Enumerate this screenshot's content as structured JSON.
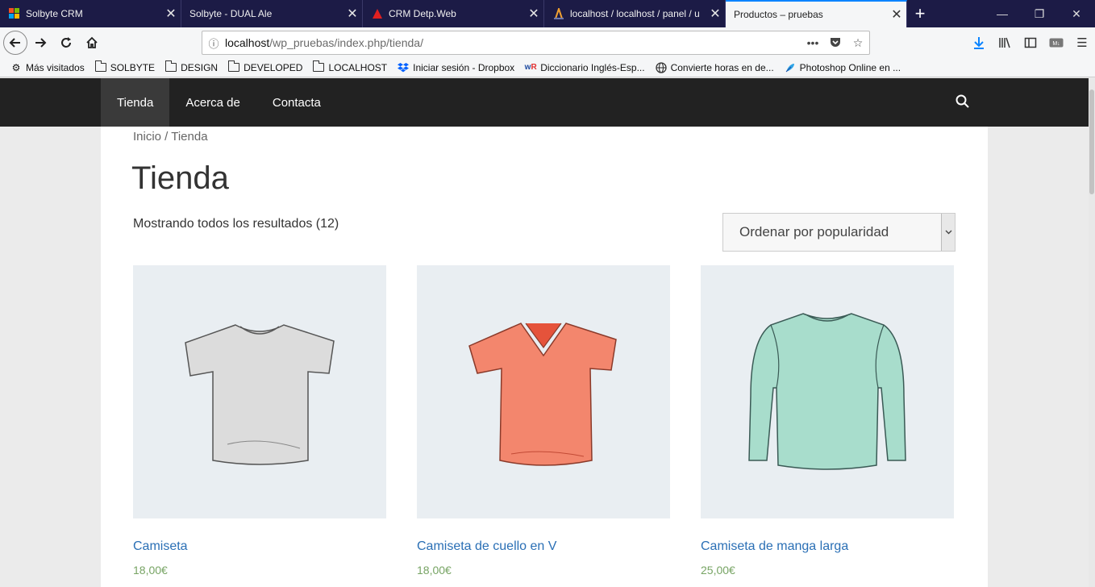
{
  "tabs": [
    {
      "title": "Solbyte CRM"
    },
    {
      "title": "Solbyte - DUAL Ale"
    },
    {
      "title": "CRM Detp.Web"
    },
    {
      "title": "localhost / localhost / panel / u"
    },
    {
      "title": "Productos – pruebas"
    }
  ],
  "address": {
    "host": "localhost",
    "path": "/wp_pruebas/index.php/tienda/"
  },
  "bookmarks": [
    {
      "label": "Más visitados",
      "icon": "gear-icon"
    },
    {
      "label": "SOLBYTE",
      "icon": "folder-icon"
    },
    {
      "label": "DESIGN",
      "icon": "folder-icon"
    },
    {
      "label": "DEVELOPED",
      "icon": "folder-icon"
    },
    {
      "label": "LOCALHOST",
      "icon": "folder-icon"
    },
    {
      "label": "Iniciar sesión - Dropbox",
      "icon": "dropbox-icon"
    },
    {
      "label": "Diccionario Inglés-Esp...",
      "icon": "wordreference-icon"
    },
    {
      "label": "Convierte horas en de...",
      "icon": "globe-icon"
    },
    {
      "label": "Photoshop Online en ...",
      "icon": "feather-icon"
    }
  ],
  "site": {
    "menu": [
      "Tienda",
      "Acerca de",
      "Contacta"
    ],
    "breadcrumb": "Inicio / Tienda",
    "title": "Tienda",
    "result_count": "Mostrando todos los resultados (12)",
    "ordering": "Ordenar por popularidad"
  },
  "products": [
    {
      "name": "Camiseta",
      "price": "18,00€",
      "color": "#d9d9d9"
    },
    {
      "name": "Camiseta de cuello en V",
      "price": "18,00€",
      "color": "#f3866d"
    },
    {
      "name": "Camiseta de manga larga",
      "price": "25,00€",
      "color": "#a8ddcc"
    }
  ]
}
